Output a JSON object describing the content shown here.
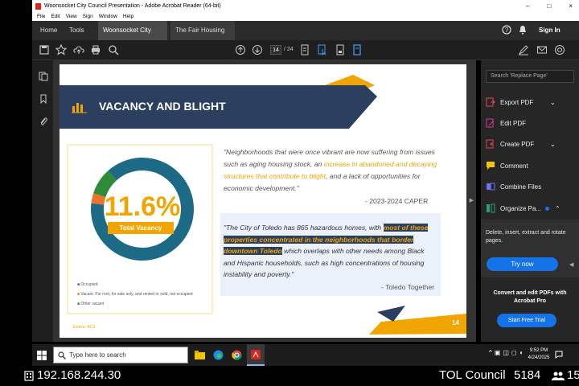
{
  "window": {
    "title": "Woonsocket City Council Presentation - Adobe Acrobat Reader (64-bit)",
    "controls": [
      "–",
      "□",
      "×"
    ]
  },
  "menu": [
    "File",
    "Edit",
    "View",
    "Sign",
    "Window",
    "Help"
  ],
  "tabs": {
    "home": "Home",
    "tools": "Tools",
    "doc1": "Woonsocket City C...",
    "doc2": "The Fair Housing C...",
    "close": "×",
    "signin": "Sign In"
  },
  "toolbar": {
    "page_current": "14",
    "page_total": "/ 24"
  },
  "slide": {
    "heading": "VACANCY AND BLIGHT",
    "donut_percent": "11.6%",
    "donut_label": "Total Vacancy",
    "legend": [
      "Occupied",
      "Vacant: For rent, for sale only, and rented or sold, not occupied",
      "Other vacant"
    ],
    "source_small": "Source: ACS",
    "quote1_part1": "\"Neighborhoods that were once vibrant are now suffering from issues such as aging housing stock, an ",
    "quote1_highlight": "increase in abandoned and decaying structures that contribute to blight",
    "quote1_part2": ", and a lack of opportunities for economic development.\"",
    "quote1_source": "- 2023-2024 CAPER",
    "quote2_part1": "\"The City of Toledo has 865 hazardous homes, with ",
    "quote2_highlight": "most of these properties concentrated in the neighborhoods that border downtown Toledo",
    "quote2_part2": " which overlaps with other needs among Black and Hispanic households, such as high concentrations of housing instability and poverty.\"",
    "quote2_source": "- Toledo Together",
    "page_number": "14"
  },
  "chart_data": {
    "type": "pie",
    "categories": [
      "Occupied",
      "Vacant: For rent, for sale only, and rented or sold, not occupied",
      "Other vacant"
    ],
    "values": [
      88.4,
      3.2,
      8.4
    ],
    "colors": [
      "#1c6a86",
      "#f0722a",
      "#2e8b37"
    ],
    "title": "",
    "center_text": "11.6%"
  },
  "rightpanel": {
    "search_placeholder": "Search 'Replace Page'",
    "tools": [
      "Export PDF",
      "Edit PDF",
      "Create PDF",
      "Comment",
      "Combine Files",
      "Organize Pa..."
    ],
    "organize_desc": "Delete, insert, extract and rotate pages.",
    "try_now": "Try now",
    "promo": "Convert and edit PDFs with Acrobat Pro",
    "start_trial": "Start Free Trial"
  },
  "taskbar": {
    "search_placeholder": "Type here to search",
    "time": "9:52 PM",
    "date": "4/24/2025"
  },
  "status": {
    "ip": "192.168.244.30",
    "label": "TOL Council",
    "code": "5184",
    "viewers": "15"
  },
  "colors": {
    "accent_orange": "#f0a500",
    "navy": "#2c3f5f",
    "acrobat_blue": "#1473e6"
  }
}
